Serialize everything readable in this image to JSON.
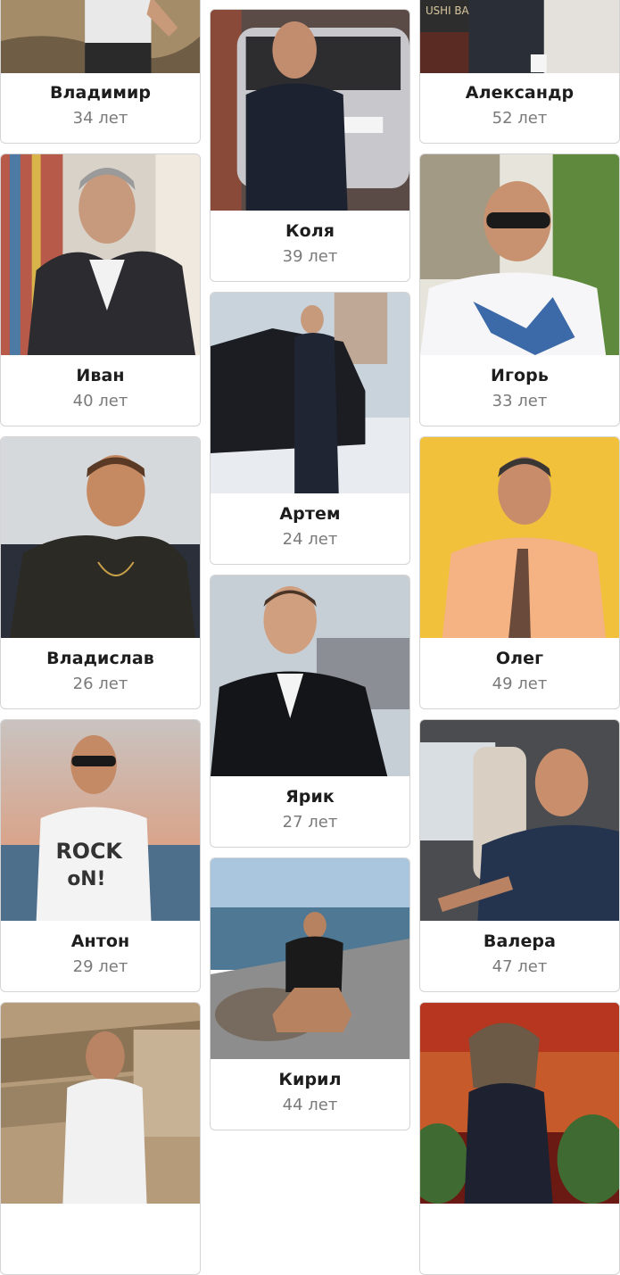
{
  "profiles": [
    {
      "name": "Владимир",
      "age": "34 лет"
    },
    {
      "name": "Александр",
      "age": "52 лет"
    },
    {
      "name": "Коля",
      "age": "39 лет"
    },
    {
      "name": "Иван",
      "age": "40 лет"
    },
    {
      "name": "Игорь",
      "age": "33 лет"
    },
    {
      "name": "Артем",
      "age": "24 лет"
    },
    {
      "name": "Владислав",
      "age": "26 лет"
    },
    {
      "name": "Олег",
      "age": "49 лет"
    },
    {
      "name": "Ярик",
      "age": "27 лет"
    },
    {
      "name": "Антон",
      "age": "29 лет"
    },
    {
      "name": "Валера",
      "age": "47 лет"
    },
    {
      "name": "Кирил",
      "age": "44 лет"
    }
  ]
}
